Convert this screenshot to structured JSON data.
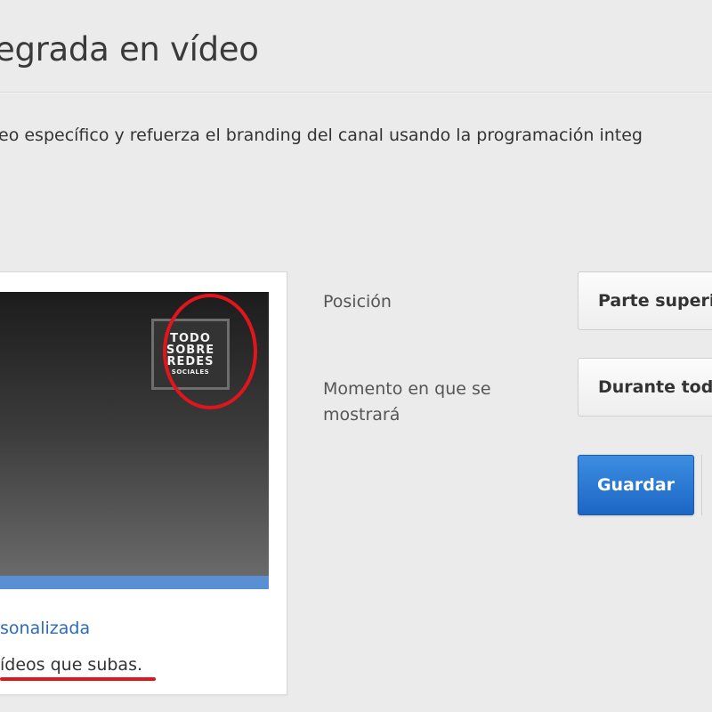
{
  "page": {
    "title": "egrada en vídeo",
    "description": "eo específico y refuerza el branding del canal usando la programación integ"
  },
  "preview": {
    "watermark_lines": [
      "TODO",
      "SOBRE",
      "REDES",
      "SOCIALES"
    ],
    "customize_link": "sonalizada",
    "apply_note": "ídeos que subas."
  },
  "settings": {
    "position_label": "Posición",
    "position_value": "Parte superior derecha",
    "timing_label_line1": "Momento en que se",
    "timing_label_line2": "mostrará",
    "timing_value": "Durante todo el vídeo",
    "save_label": "Guardar"
  },
  "colors": {
    "accent_blue": "#2b6bbf",
    "button_blue": "#1d66c4",
    "highlight_red": "#e0161c",
    "background": "#ebebeb"
  }
}
